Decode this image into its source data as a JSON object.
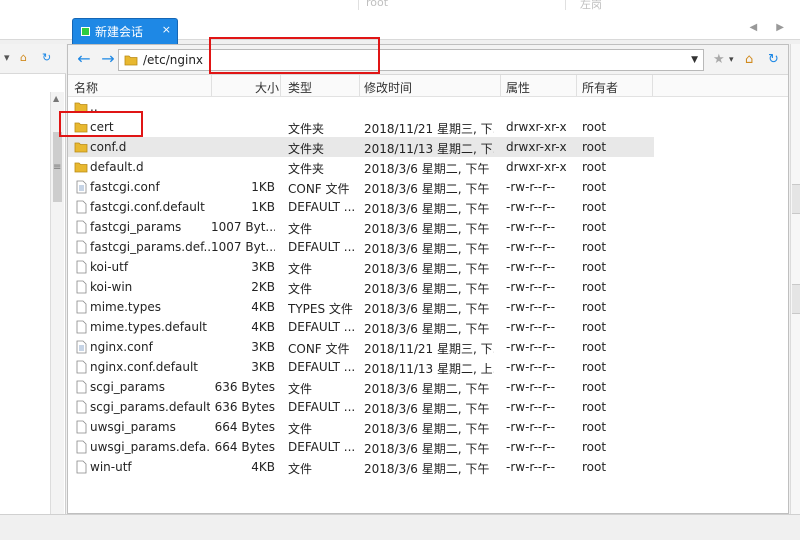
{
  "top": {
    "faded_left": "root",
    "faded_right": "左岗",
    "arrows": "◀ ▶"
  },
  "session_tab": {
    "label": "新建会话",
    "close": "×"
  },
  "left_toolbar": {
    "arrow": "▾",
    "home": "⌂",
    "refresh": "↻"
  },
  "left_scroll": {
    "up": "▲",
    "down": "▼",
    "grip": "≡"
  },
  "toolbar": {
    "back": "←",
    "forward": "→",
    "path": "/etc/nginx",
    "dropdown": "▼",
    "star": "★",
    "star_arrow": "▾",
    "home": "⌂",
    "refresh": "↻"
  },
  "columns": {
    "name": "名称",
    "size": "大小",
    "type": "类型",
    "mtime": "修改时间",
    "perm": "属性",
    "owner": "所有者"
  },
  "rows": [
    {
      "name": "..",
      "size": "",
      "type": "",
      "mtime": "",
      "perm": "",
      "owner": "",
      "icon": "folder-up"
    },
    {
      "name": "cert",
      "size": "",
      "type": "文件夹",
      "mtime": "2018/11/21 星期三, 下...",
      "perm": "drwxr-xr-x",
      "owner": "root",
      "icon": "folder"
    },
    {
      "name": "conf.d",
      "size": "",
      "type": "文件夹",
      "mtime": "2018/11/13 星期二, 下...",
      "perm": "drwxr-xr-x",
      "owner": "root",
      "icon": "folder"
    },
    {
      "name": "default.d",
      "size": "",
      "type": "文件夹",
      "mtime": "2018/3/6 星期二, 下午 ...",
      "perm": "drwxr-xr-x",
      "owner": "root",
      "icon": "folder"
    },
    {
      "name": "fastcgi.conf",
      "size": "1KB",
      "type": "CONF 文件",
      "mtime": "2018/3/6 星期二, 下午 ...",
      "perm": "-rw-r--r--",
      "owner": "root",
      "icon": "conf"
    },
    {
      "name": "fastcgi.conf.default",
      "size": "1KB",
      "type": "DEFAULT ...",
      "mtime": "2018/3/6 星期二, 下午 ...",
      "perm": "-rw-r--r--",
      "owner": "root",
      "icon": "file"
    },
    {
      "name": "fastcgi_params",
      "size": "1007 Byt...",
      "type": "文件",
      "mtime": "2018/3/6 星期二, 下午 ...",
      "perm": "-rw-r--r--",
      "owner": "root",
      "icon": "file"
    },
    {
      "name": "fastcgi_params.def...",
      "size": "1007 Byt...",
      "type": "DEFAULT ...",
      "mtime": "2018/3/6 星期二, 下午 ...",
      "perm": "-rw-r--r--",
      "owner": "root",
      "icon": "file"
    },
    {
      "name": "koi-utf",
      "size": "3KB",
      "type": "文件",
      "mtime": "2018/3/6 星期二, 下午 ...",
      "perm": "-rw-r--r--",
      "owner": "root",
      "icon": "file"
    },
    {
      "name": "koi-win",
      "size": "2KB",
      "type": "文件",
      "mtime": "2018/3/6 星期二, 下午 ...",
      "perm": "-rw-r--r--",
      "owner": "root",
      "icon": "file"
    },
    {
      "name": "mime.types",
      "size": "4KB",
      "type": "TYPES 文件",
      "mtime": "2018/3/6 星期二, 下午 ...",
      "perm": "-rw-r--r--",
      "owner": "root",
      "icon": "file"
    },
    {
      "name": "mime.types.default",
      "size": "4KB",
      "type": "DEFAULT ...",
      "mtime": "2018/3/6 星期二, 下午 ...",
      "perm": "-rw-r--r--",
      "owner": "root",
      "icon": "file"
    },
    {
      "name": "nginx.conf",
      "size": "3KB",
      "type": "CONF 文件",
      "mtime": "2018/11/21 星期三, 下...",
      "perm": "-rw-r--r--",
      "owner": "root",
      "icon": "conf"
    },
    {
      "name": "nginx.conf.default",
      "size": "3KB",
      "type": "DEFAULT ...",
      "mtime": "2018/11/13 星期二, 上...",
      "perm": "-rw-r--r--",
      "owner": "root",
      "icon": "file"
    },
    {
      "name": "scgi_params",
      "size": "636 Bytes",
      "type": "文件",
      "mtime": "2018/3/6 星期二, 下午 ...",
      "perm": "-rw-r--r--",
      "owner": "root",
      "icon": "file"
    },
    {
      "name": "scgi_params.default",
      "size": "636 Bytes",
      "type": "DEFAULT ...",
      "mtime": "2018/3/6 星期二, 下午 ...",
      "perm": "-rw-r--r--",
      "owner": "root",
      "icon": "file"
    },
    {
      "name": "uwsgi_params",
      "size": "664 Bytes",
      "type": "文件",
      "mtime": "2018/3/6 星期二, 下午 ...",
      "perm": "-rw-r--r--",
      "owner": "root",
      "icon": "file"
    },
    {
      "name": "uwsgi_params.defa...",
      "size": "664 Bytes",
      "type": "DEFAULT ...",
      "mtime": "2018/3/6 星期二, 下午 ...",
      "perm": "-rw-r--r--",
      "owner": "root",
      "icon": "file"
    },
    {
      "name": "win-utf",
      "size": "4KB",
      "type": "文件",
      "mtime": "2018/3/6 星期二, 下午 ...",
      "perm": "-rw-r--r--",
      "owner": "root",
      "icon": "file"
    }
  ],
  "selected_row": 2,
  "colors": {
    "accent": "#1e88e5",
    "highlight": "#e01515",
    "folder": "#e8b830"
  }
}
